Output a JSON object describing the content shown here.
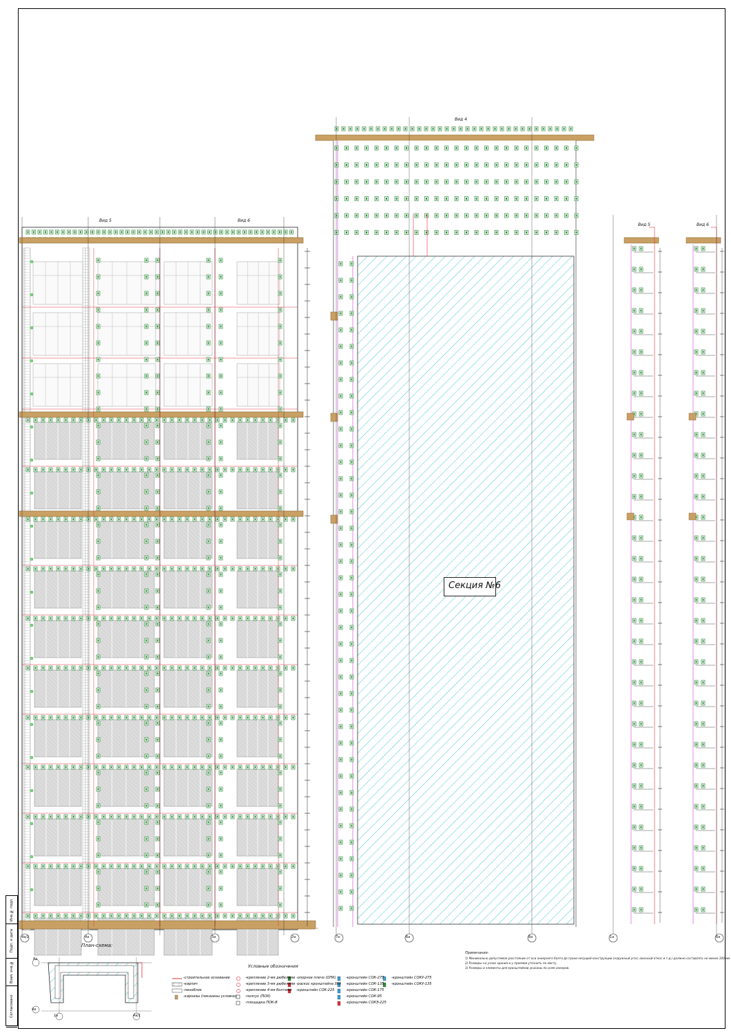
{
  "views": {
    "view4": "Вид 4",
    "view5": "Вид 5",
    "view6": "Вид 6"
  },
  "section_label": "Секция №6",
  "plan_title": "План-схема:",
  "axes_bottom": [
    "4а/1",
    "4а",
    "3а",
    "2а",
    "7а",
    "6а",
    "8а",
    "1а",
    "6а"
  ],
  "plan_axes": [
    "8а",
    "4а",
    "1а",
    "4а/1"
  ],
  "legend": {
    "title": "Условные обозначения",
    "col1": [
      "-строительное основание",
      "-кирпич",
      "-пеноблок",
      "-карнизы (показаны условно)"
    ],
    "col2": [
      "-крепление 2-мя дюбелями",
      "-крепление 3-мя дюбелями",
      "-крепление 4-мя болтами",
      "-полсух (ПОК)",
      "-площадка ПОК-В"
    ],
    "col3": [
      "-опорное плечо (ОПК)",
      "-раскос кронштейна 380",
      "-кронштейн СОК-225"
    ],
    "col4": [
      "-кронштейн СОК-275",
      "-кронштейн СОК-135",
      "-кронштейн СОК-175",
      "-кронштейн СОК-95",
      "-кронштейн СОКЭ-225"
    ],
    "col5": [
      "-кронштейн СОКУ-275",
      "-кронштейн СОКУ-135"
    ]
  },
  "notes": {
    "title": "Примечания:",
    "items": [
      "1) Минимально допустимое расстояние от оси анкерного болта до грани несущей конструкции (наружный угол, оконный откос и т.д.) должно составлять не менее 100 мм",
      "2) Размеры на узлах здания и у проемов уточнить по месту.",
      "3) Размеры и элементы для кронштейнов указаны по осям анкеров."
    ]
  },
  "stamp": [
    "Инв.№ подл.",
    "Подп. и дата",
    "Взам. инв.№",
    "Согласовано"
  ],
  "colors": {
    "line": "#111111",
    "red": "#e0303a",
    "magenta": "#d63bd8",
    "hatch": "#46c6c9",
    "green": "#2e8b3a",
    "wood": "#c9a063"
  }
}
